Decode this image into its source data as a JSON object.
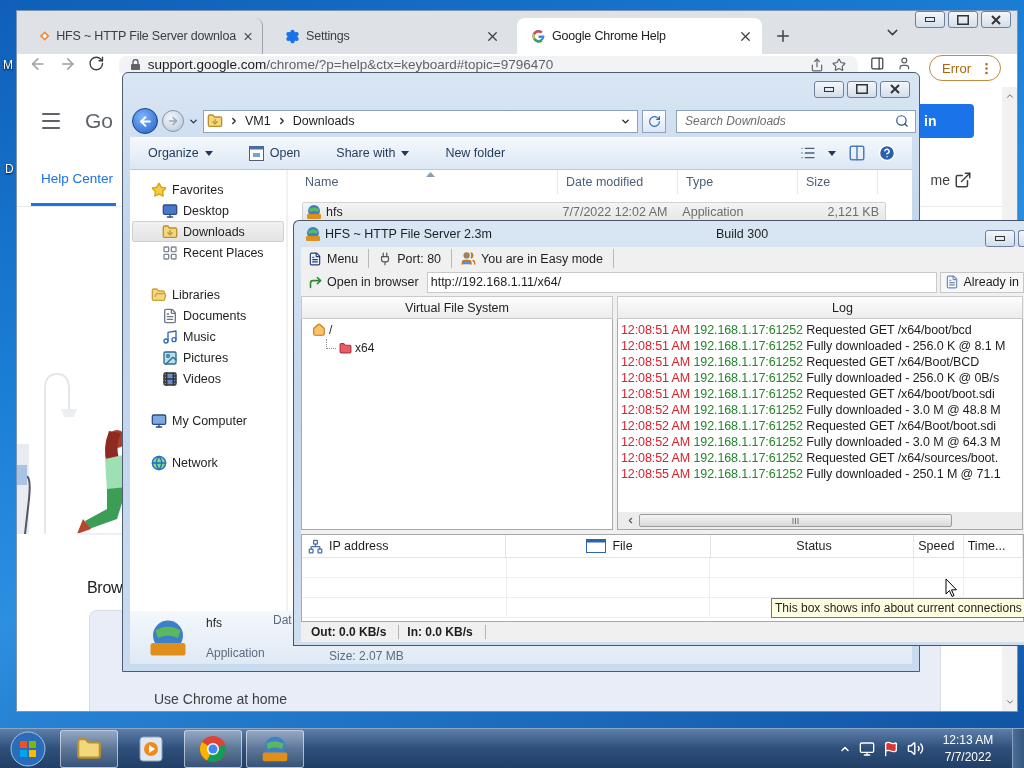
{
  "desktop": {
    "icon_labels": [
      "M",
      "D"
    ]
  },
  "chrome": {
    "tabs": [
      {
        "title": "HFS ~ HTTP File Server downloa",
        "selected": false
      },
      {
        "title": "Settings",
        "selected": false
      },
      {
        "title": "Google Chrome Help",
        "selected": true
      }
    ],
    "address": {
      "host": "support.google.com",
      "path": "/chrome/?p=help&ctx=keyboard#topic=9796470"
    },
    "profile_status": "Error",
    "page": {
      "logo": "Go",
      "sign_in": "in",
      "nav_tab": "Help Center",
      "side_link": "me",
      "heading": "Brow",
      "card_text": "Use Chrome at home"
    }
  },
  "explorer": {
    "breadcrumb": [
      "VM1",
      "Downloads"
    ],
    "search_placeholder": "Search Downloads",
    "commands": [
      {
        "label": "Organize",
        "kind": "menu"
      },
      {
        "label": "Open",
        "kind": "icon"
      },
      {
        "label": "Share with",
        "kind": "menu"
      },
      {
        "label": "New folder",
        "kind": "plain"
      }
    ],
    "nav": [
      {
        "label": "Favorites",
        "selected": false,
        "children": [
          {
            "label": "Desktop",
            "selected": false
          },
          {
            "label": "Downloads",
            "selected": true
          },
          {
            "label": "Recent Places",
            "selected": false
          }
        ]
      },
      {
        "label": "Libraries",
        "selected": false,
        "children": [
          {
            "label": "Documents",
            "selected": false
          },
          {
            "label": "Music",
            "selected": false
          },
          {
            "label": "Pictures",
            "selected": false
          },
          {
            "label": "Videos",
            "selected": false
          }
        ]
      },
      {
        "label": "My Computer",
        "selected": false
      },
      {
        "label": "Network",
        "selected": false
      }
    ],
    "columns": [
      "Name",
      "Date modified",
      "Type",
      "Size"
    ],
    "files": [
      {
        "name": "hfs",
        "date": "7/7/2022 12:02 AM",
        "type": "Application",
        "size": "2,121 KB",
        "selected": true
      }
    ],
    "details": {
      "name": "hfs",
      "type": "Application",
      "date_label": "Dat",
      "size": "Size: 2.07 MB"
    }
  },
  "hfs": {
    "title": "HFS ~ HTTP File Server 2.3m",
    "build": "Build 300",
    "toolbar": [
      "Menu",
      "Port: 80",
      "You are in Easy mode"
    ],
    "open_in_browser": "Open in browser",
    "url": "http://192.168.1.11/x64/",
    "already_in": "Already in",
    "vfs": {
      "header": "Virtual File System",
      "tree": [
        {
          "label": "/",
          "expanded": true,
          "children": [
            {
              "label": "x64"
            }
          ]
        }
      ]
    },
    "log": {
      "header": "Log",
      "entries": [
        {
          "time": "12:08:51 AM",
          "address": "192.168.1.17:61252",
          "message": "Requested GET /x64/boot/bcd"
        },
        {
          "time": "12:08:51 AM",
          "address": "192.168.1.17:61252",
          "message": "Fully downloaded - 256.0 K @ 8.1 M"
        },
        {
          "time": "12:08:51 AM",
          "address": "192.168.1.17:61252",
          "message": "Requested GET /x64/Boot/BCD"
        },
        {
          "time": "12:08:51 AM",
          "address": "192.168.1.17:61252",
          "message": "Fully downloaded - 256.0 K @ 0B/s"
        },
        {
          "time": "12:08:51 AM",
          "address": "192.168.1.17:61252",
          "message": "Requested GET /x64/boot/boot.sdi"
        },
        {
          "time": "12:08:52 AM",
          "address": "192.168.1.17:61252",
          "message": "Fully downloaded - 3.0 M @ 48.8 M"
        },
        {
          "time": "12:08:52 AM",
          "address": "192.168.1.17:61252",
          "message": "Requested GET /x64/Boot/boot.sdi"
        },
        {
          "time": "12:08:52 AM",
          "address": "192.168.1.17:61252",
          "message": "Fully downloaded - 3.0 M @ 64.3 M"
        },
        {
          "time": "12:08:52 AM",
          "address": "192.168.1.17:61252",
          "message": "Requested GET /x64/sources/boot."
        },
        {
          "time": "12:08:55 AM",
          "address": "192.168.1.17:61252",
          "message": "Fully downloaded - 250.1 M @ 71.1"
        }
      ]
    },
    "connections": {
      "columns": [
        "IP address",
        "File",
        "Status",
        "Speed",
        "Time..."
      ]
    },
    "tooltip": "This box shows info about current connections",
    "status": [
      "Out: 0.0 KB/s",
      "In: 0.0 KB/s"
    ]
  },
  "taskbar": {
    "time": "12:13 AM",
    "date": "7/7/2022"
  }
}
